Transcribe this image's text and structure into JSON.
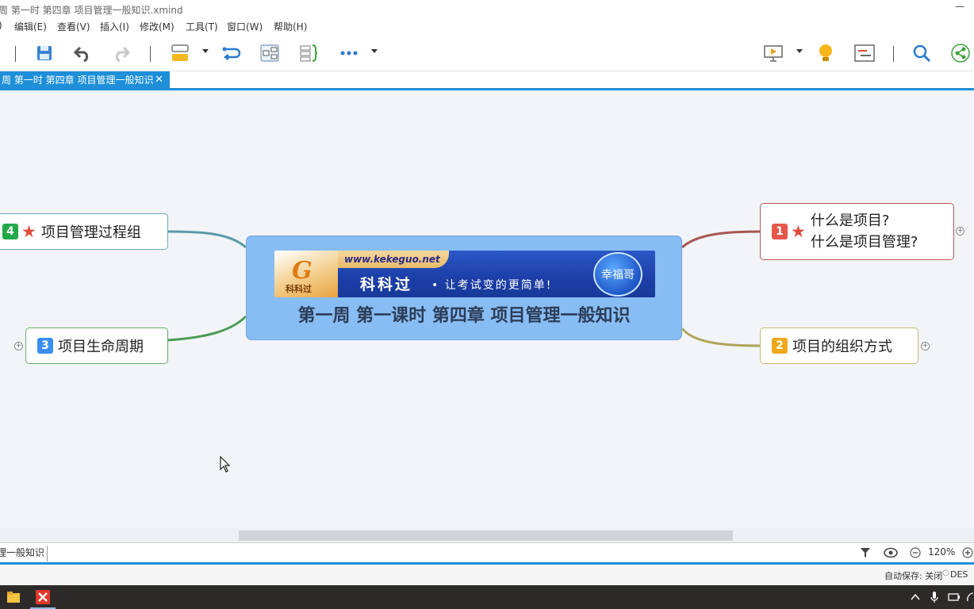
{
  "window": {
    "title": "一周  第一时 第四章 项目管理一般知识.xmind"
  },
  "menu": {
    "items": [
      ")",
      "编辑(E)",
      "查看(V)",
      "插入(I)",
      "修改(M)",
      "工具(T)",
      "窗口(W)",
      "帮助(H)"
    ]
  },
  "tab": {
    "label": "周  第一时 第四章 项目管理一般知识",
    "close": "✕"
  },
  "mindmap": {
    "central": {
      "title": "第一周 第一课时 第四章 项目管理一般知识",
      "banner": {
        "url": "www.kekeguo.net",
        "name": "科科过",
        "slogan": "• 让考试变的更简单!",
        "logo_text": "科科过",
        "badge": "幸福哥"
      }
    },
    "topics": [
      {
        "number": "1",
        "color": "#e6574c",
        "starred": true,
        "lines": [
          "什么是项目?",
          "什么是项目管理?"
        ]
      },
      {
        "number": "2",
        "color": "#f0a81b",
        "starred": false,
        "lines": [
          "项目的组织方式"
        ]
      },
      {
        "number": "3",
        "color": "#3a8ef0",
        "starred": false,
        "lines": [
          "项目生命周期"
        ]
      },
      {
        "number": "4",
        "color": "#23a84a",
        "starred": true,
        "lines": [
          "项目管理过程组"
        ]
      }
    ]
  },
  "status": {
    "breadcrumb": "理一般知识",
    "zoom": "120%",
    "autosave": "自动保存: 关闭",
    "extra": "DES"
  },
  "colors": {
    "accent": "#1e8fd8",
    "central_fill": "#88bdf4",
    "branch_1": "#a7564f",
    "branch_2": "#b0a45c",
    "branch_3": "#4b9b55",
    "branch_4": "#5c9aa8"
  }
}
